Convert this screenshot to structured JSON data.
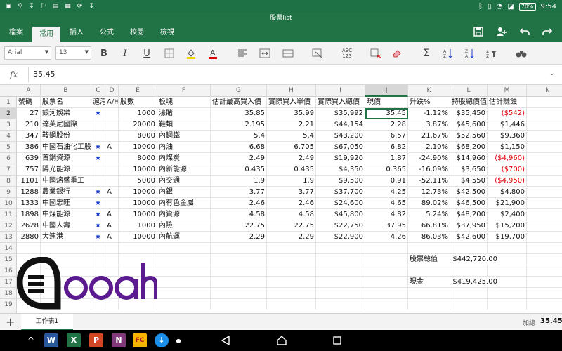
{
  "status": {
    "battery": "70%",
    "time": "9:54"
  },
  "window": {
    "title": "股票list"
  },
  "ribbon": {
    "tabs": [
      "檔案",
      "常用",
      "插入",
      "公式",
      "校閱",
      "檢視"
    ],
    "active_tab": "常用"
  },
  "toolbar": {
    "font": "Arial",
    "size": "13",
    "number_format_label": "ABC\n123"
  },
  "formula": {
    "fx": "fx",
    "value": "35.45"
  },
  "columns": [
    "A",
    "B",
    "C",
    "D",
    "E",
    "F",
    "G",
    "H",
    "I",
    "J",
    "K",
    "L",
    "M",
    "N"
  ],
  "row_numbers": [
    "1",
    "2",
    "3",
    "4",
    "5",
    "6",
    "7",
    "8",
    "9",
    "10",
    "11",
    "12",
    "13",
    "14",
    "15",
    "16",
    "17",
    "18",
    "19"
  ],
  "header_row": [
    "號碼",
    "股票名",
    "滬港",
    "A/H",
    "股數",
    "板塊",
    "估計最高買入價",
    "實際買入單價",
    "實際買入總價",
    "現價",
    "升跌%",
    "持股總價值",
    "估計賺蝕"
  ],
  "rows": [
    [
      "27",
      "銀河娛樂",
      "★",
      "",
      "1000",
      "濠賭",
      "35.85",
      "35.99",
      "$35,992",
      "35.45",
      "-1.12%",
      "$35,450",
      "($542)"
    ],
    [
      "210",
      "達芙尼國際",
      "",
      "",
      "20000",
      "鞋類",
      "2.195",
      "2.21",
      "$44,154",
      "2.28",
      "3.87%",
      "$45,600",
      "$1,446"
    ],
    [
      "347",
      "鞍鋼股份",
      "",
      "",
      "8000",
      "內鋼鐵",
      "5.4",
      "5.4",
      "$43,200",
      "6.57",
      "21.67%",
      "$52,560",
      "$9,360"
    ],
    [
      "386",
      "中國石油化工股份",
      "★",
      "A",
      "10000",
      "內油",
      "6.68",
      "6.705",
      "$67,050",
      "6.82",
      "2.10%",
      "$68,200",
      "$1,150"
    ],
    [
      "639",
      "首鋼資源",
      "★",
      "",
      "8000",
      "內煤炭",
      "2.49",
      "2.49",
      "$19,920",
      "1.87",
      "-24.90%",
      "$14,960",
      "($4,960)"
    ],
    [
      "757",
      "陽光能源",
      "",
      "",
      "10000",
      "內新能源",
      "0.435",
      "0.435",
      "$4,350",
      "0.365",
      "-16.09%",
      "$3,650",
      "($700)"
    ],
    [
      "1101",
      "中國熔盛重工",
      "",
      "",
      "5000",
      "內交通",
      "1.9",
      "1.9",
      "$9,500",
      "0.91",
      "-52.11%",
      "$4,550",
      "($4,950)"
    ],
    [
      "1288",
      "農業銀行",
      "★",
      "A",
      "10000",
      "內銀",
      "3.77",
      "3.77",
      "$37,700",
      "4.25",
      "12.73%",
      "$42,500",
      "$4,800"
    ],
    [
      "1333",
      "中國忠旺",
      "★",
      "",
      "10000",
      "內有色金屬",
      "2.46",
      "2.46",
      "$24,600",
      "4.65",
      "89.02%",
      "$46,500",
      "$21,900"
    ],
    [
      "1898",
      "中煤能源",
      "★",
      "A",
      "10000",
      "內資源",
      "4.58",
      "4.58",
      "$45,800",
      "4.82",
      "5.24%",
      "$48,200",
      "$2,400"
    ],
    [
      "2628",
      "中國人壽",
      "★",
      "A",
      "1000",
      "內險",
      "22.75",
      "22.75",
      "$22,750",
      "37.95",
      "66.81%",
      "$37,950",
      "$15,200"
    ],
    [
      "2880",
      "大連港",
      "★",
      "A",
      "10000",
      "內航運",
      "2.29",
      "2.29",
      "$22,900",
      "4.26",
      "86.03%",
      "$42,600",
      "$19,700"
    ]
  ],
  "summary": {
    "total_label": "股票總值",
    "total_value": "$442,720.00",
    "cash_label": "現金",
    "cash_value": "$419,425.00"
  },
  "logo": {
    "text": "Qooah"
  },
  "sheet": {
    "tab": "工作表1",
    "sum_label": "加總",
    "sum_value": "35.45"
  },
  "colors": {
    "accent": "#217346",
    "negative": "#e00000",
    "star": "#1d3fd1",
    "logo": "#5b1a8f"
  }
}
